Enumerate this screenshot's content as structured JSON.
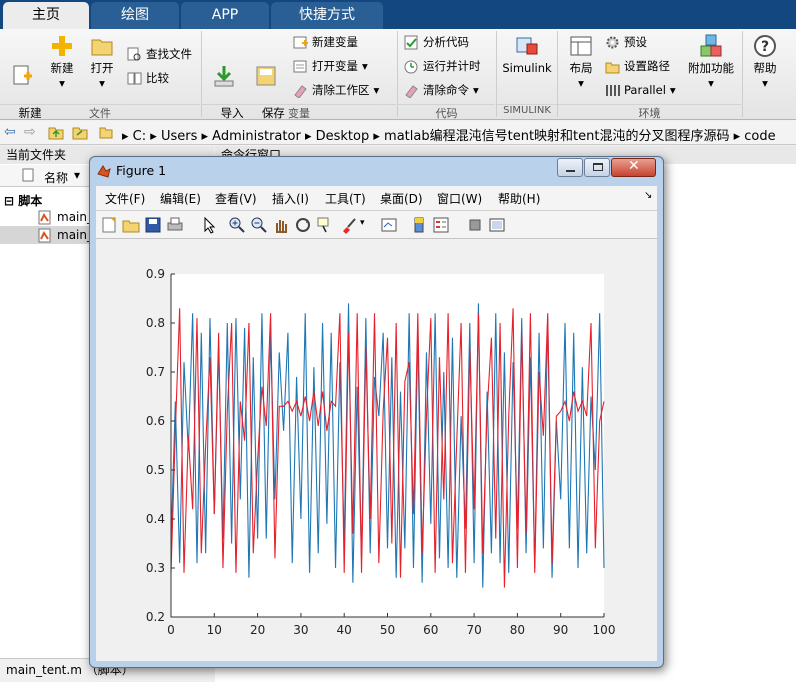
{
  "tabs": [
    "主页",
    "绘图",
    "APP",
    "快捷方式"
  ],
  "ribbon": {
    "file": {
      "new_script": "新建\n脚本",
      "new": "新建",
      "open": "打开",
      "find_files": "查找文件",
      "compare": "比较",
      "group": "文件"
    },
    "variable": {
      "import": "导入\n数据",
      "save_ws": "保存\n工作区",
      "new_var": "新建变量",
      "open_var": "打开变量",
      "clear_ws": "清除工作区",
      "group": "变量"
    },
    "code": {
      "analyze": "分析代码",
      "run_time": "运行并计时",
      "clear_cmd": "清除命令",
      "group": "代码"
    },
    "simulink": {
      "label": "Simulink",
      "group": "SIMULINK"
    },
    "env": {
      "layout": "布局",
      "prefs": "预设",
      "set_path": "设置路径",
      "parallel": "Parallel",
      "addons": "附加功能",
      "group": "环境"
    },
    "help": "帮助"
  },
  "address": {
    "parts": [
      "C:",
      "Users",
      "Administrator",
      "Desktop",
      "matlab编程混沌信号tent映射和tent混沌的分叉图程序源码",
      "code"
    ]
  },
  "current_folder": {
    "title": "当前文件夹",
    "col_name": "名称",
    "section": "脚本",
    "files": [
      "main_",
      "main_"
    ],
    "status": "main_tent.m （脚本）"
  },
  "command_window": {
    "title": "命令行窗口"
  },
  "figure": {
    "title": "Figure 1",
    "menus": [
      "文件(F)",
      "编辑(E)",
      "查看(V)",
      "插入(I)",
      "工具(T)",
      "桌面(D)",
      "窗口(W)",
      "帮助(H)"
    ]
  },
  "chart_data": {
    "type": "line",
    "xlim": [
      0,
      100
    ],
    "ylim": [
      0.2,
      0.9
    ],
    "xticks": [
      0,
      10,
      20,
      30,
      40,
      50,
      60,
      70,
      80,
      90,
      100
    ],
    "yticks": [
      0.2,
      0.3,
      0.4,
      0.5,
      0.6,
      0.7,
      0.8,
      0.9
    ],
    "grid": false,
    "series": [
      {
        "color": "#1f77b4",
        "values": [
          0.35,
          0.64,
          0.31,
          0.72,
          0.54,
          0.82,
          0.31,
          0.78,
          0.33,
          0.81,
          0.41,
          0.75,
          0.36,
          0.8,
          0.35,
          0.81,
          0.44,
          0.79,
          0.28,
          0.73,
          0.36,
          0.82,
          0.36,
          0.78,
          0.44,
          0.74,
          0.58,
          0.78,
          0.31,
          0.69,
          0.4,
          0.82,
          0.29,
          0.71,
          0.33,
          0.8,
          0.39,
          0.78,
          0.3,
          0.72,
          0.35,
          0.84,
          0.27,
          0.67,
          0.32,
          0.81,
          0.33,
          0.69,
          0.61,
          0.78,
          0.34,
          0.73,
          0.28,
          0.66,
          0.34,
          0.82,
          0.3,
          0.78,
          0.27,
          0.74,
          0.39,
          0.82,
          0.32,
          0.7,
          0.3,
          0.77,
          0.28,
          0.61,
          0.38,
          0.8,
          0.31,
          0.84,
          0.26,
          0.66,
          0.33,
          0.82,
          0.31,
          0.74,
          0.29,
          0.72,
          0.38,
          0.81,
          0.33,
          0.73,
          0.3,
          0.78,
          0.34,
          0.81,
          0.28,
          0.6,
          0.44,
          0.8,
          0.34,
          0.78,
          0.3,
          0.71,
          0.33,
          0.65,
          0.5,
          0.82,
          0.3
        ]
      },
      {
        "color": "#e6212b",
        "values": [
          0.29,
          0.58,
          0.83,
          0.29,
          0.57,
          0.42,
          0.81,
          0.33,
          0.55,
          0.73,
          0.41,
          0.78,
          0.3,
          0.62,
          0.8,
          0.29,
          0.64,
          0.56,
          0.8,
          0.33,
          0.52,
          0.67,
          0.59,
          0.82,
          0.32,
          0.63,
          0.63,
          0.64,
          0.62,
          0.64,
          0.61,
          0.65,
          0.6,
          0.66,
          0.59,
          0.66,
          0.58,
          0.64,
          0.63,
          0.82,
          0.29,
          0.78,
          0.37,
          0.82,
          0.29,
          0.75,
          0.4,
          0.82,
          0.31,
          0.62,
          0.77,
          0.35,
          0.8,
          0.28,
          0.68,
          0.72,
          0.41,
          0.82,
          0.33,
          0.61,
          0.81,
          0.29,
          0.73,
          0.44,
          0.82,
          0.31,
          0.56,
          0.8,
          0.29,
          0.75,
          0.42,
          0.82,
          0.33,
          0.62,
          0.77,
          0.36,
          0.8,
          0.26,
          0.61,
          0.83,
          0.3,
          0.78,
          0.37,
          0.82,
          0.29,
          0.7,
          0.57,
          0.82,
          0.31,
          0.61,
          0.62,
          0.64,
          0.6,
          0.66,
          0.62,
          0.64,
          0.61,
          0.8,
          0.34,
          0.6,
          0.64
        ]
      }
    ]
  }
}
